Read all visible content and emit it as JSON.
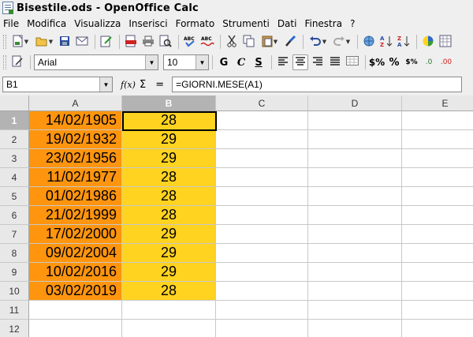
{
  "window": {
    "title": "Bisestile.ods - OpenOffice Calc"
  },
  "menu": [
    "File",
    "Modifica",
    "Visualizza",
    "Inserisci",
    "Formato",
    "Strumenti",
    "Dati",
    "Finestra",
    "?"
  ],
  "formatting": {
    "font_name": "Arial",
    "font_size": "10",
    "bold_label": "G",
    "italic_label": "C",
    "underline_label": "S",
    "currency_label": "$%",
    "percent_label": "%",
    "standard_label": "$%",
    "add_decimal_label": ".0",
    "remove_decimal_label": ".00"
  },
  "formula_bar": {
    "name_box": "B1",
    "fx_label": "f(x)",
    "sigma_label": "Σ",
    "equals_label": "=",
    "formula": "=GIORNI.MESE(A1)"
  },
  "sheet": {
    "columns": [
      "A",
      "B",
      "C",
      "D",
      "E"
    ],
    "selected_column": "B",
    "selected_row": 1,
    "rows": [
      {
        "num": "1",
        "a": "14/02/1905",
        "b": "28"
      },
      {
        "num": "2",
        "a": "19/02/1932",
        "b": "29"
      },
      {
        "num": "3",
        "a": "23/02/1956",
        "b": "29"
      },
      {
        "num": "4",
        "a": "11/02/1977",
        "b": "28"
      },
      {
        "num": "5",
        "a": "01/02/1986",
        "b": "28"
      },
      {
        "num": "6",
        "a": "21/02/1999",
        "b": "28"
      },
      {
        "num": "7",
        "a": "17/02/2000",
        "b": "29"
      },
      {
        "num": "8",
        "a": "09/02/2004",
        "b": "29"
      },
      {
        "num": "9",
        "a": "10/02/2016",
        "b": "29"
      },
      {
        "num": "10",
        "a": "03/02/2019",
        "b": "28"
      },
      {
        "num": "11",
        "a": "",
        "b": ""
      },
      {
        "num": "12",
        "a": "",
        "b": ""
      }
    ]
  },
  "colors": {
    "column_a_fill": "#ff950e",
    "column_b_fill": "#ffd320",
    "header_selected": "#b3b3b3"
  },
  "icons": [
    "new-icon",
    "open-icon",
    "save-icon",
    "email-icon",
    "edit-file-icon",
    "export-pdf-icon",
    "print-icon",
    "page-preview-icon",
    "spellcheck-icon",
    "autospellcheck-icon",
    "cut-icon",
    "copy-icon",
    "paste-icon",
    "format-paintbrush-icon",
    "undo-icon",
    "redo-icon",
    "hyperlink-icon",
    "sort-ascending-icon",
    "sort-descending-icon",
    "chart-icon",
    "navigator-icon",
    "stylist-icon",
    "align-left-icon",
    "align-center-icon",
    "align-right-icon",
    "justify-icon",
    "merge-cells-icon"
  ]
}
